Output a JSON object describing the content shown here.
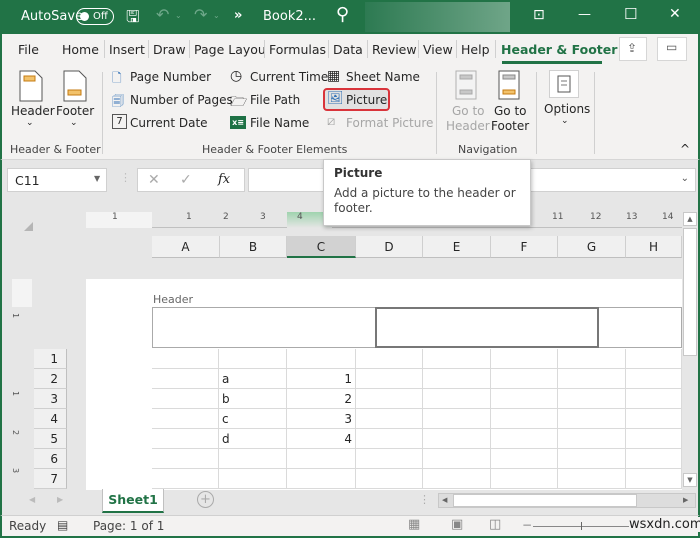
{
  "titlebar": {
    "autosave_label": "AutoSave",
    "autosave_state": "Off",
    "more_label": "»",
    "doc_title": "Book2...",
    "icons": [
      "save-icon",
      "undo-icon",
      "redo-icon",
      "search-icon",
      "ribbon-display-icon",
      "minimize-icon",
      "maximize-icon",
      "close-icon"
    ],
    "glyphs": {
      "save": "🖫",
      "undo": "↶",
      "redo": "↷",
      "search": "⚲",
      "ribbon": "⊡",
      "minimize": "—",
      "maximize": "☐",
      "close": "✕"
    }
  },
  "tabs": {
    "items": [
      "File",
      "Home",
      "Insert",
      "Draw",
      "Page Layou",
      "Formulas",
      "Data",
      "Review",
      "View",
      "Help",
      "Header & Footer"
    ],
    "active": "Header & Footer",
    "share_icon": "share-icon",
    "comments_icon": "comments-icon"
  },
  "ribbon": {
    "header_footer_group": {
      "label": "Header & Footer",
      "header_btn": "Header",
      "footer_btn": "Footer"
    },
    "elements_group": {
      "label": "Header & Footer Elements",
      "page_number": "Page Number",
      "number_of_pages": "Number of Pages",
      "current_date": "Current Date",
      "current_time": "Current Time",
      "file_path": "File Path",
      "file_name": "File Name",
      "sheet_name": "Sheet Name",
      "picture": "Picture",
      "format_picture": "Format Picture"
    },
    "navigation_group": {
      "label": "Navigation",
      "go_to_header_l1": "Go to",
      "go_to_header_l2": "Header",
      "go_to_footer_l1": "Go to",
      "go_to_footer_l2": "Footer"
    },
    "options_group": {
      "options_btn": "Options"
    },
    "collapse_glyph": "^"
  },
  "formula_bar": {
    "name_box": "C11",
    "cancel": "✕",
    "enter": "✓",
    "fx": "fx",
    "formula": ""
  },
  "tooltip": {
    "title": "Picture",
    "description": "Add a picture to the header or footer."
  },
  "ruler": {
    "top_marks": [
      "1",
      "1",
      "2",
      "3",
      "4",
      "11",
      "12",
      "13",
      "14"
    ],
    "left_marks": [
      "1",
      "2",
      "3"
    ]
  },
  "grid": {
    "columns": [
      "A",
      "B",
      "C",
      "D",
      "E",
      "F",
      "G",
      "H"
    ],
    "selected_column": "C",
    "header_area_label": "Header",
    "rows": [
      {
        "num": "1",
        "B": "",
        "C": ""
      },
      {
        "num": "2",
        "B": "a",
        "C": "1"
      },
      {
        "num": "3",
        "B": "b",
        "C": "2"
      },
      {
        "num": "4",
        "B": "c",
        "C": "3"
      },
      {
        "num": "5",
        "B": "d",
        "C": "4"
      },
      {
        "num": "6",
        "B": "",
        "C": ""
      },
      {
        "num": "7",
        "B": "",
        "C": ""
      }
    ]
  },
  "sheet_tabs": {
    "tabs": [
      "Sheet1"
    ],
    "add_glyph": "+"
  },
  "status": {
    "ready": "Ready",
    "page": "Page: 1 of 1",
    "watermark": "wsxdn.com"
  }
}
